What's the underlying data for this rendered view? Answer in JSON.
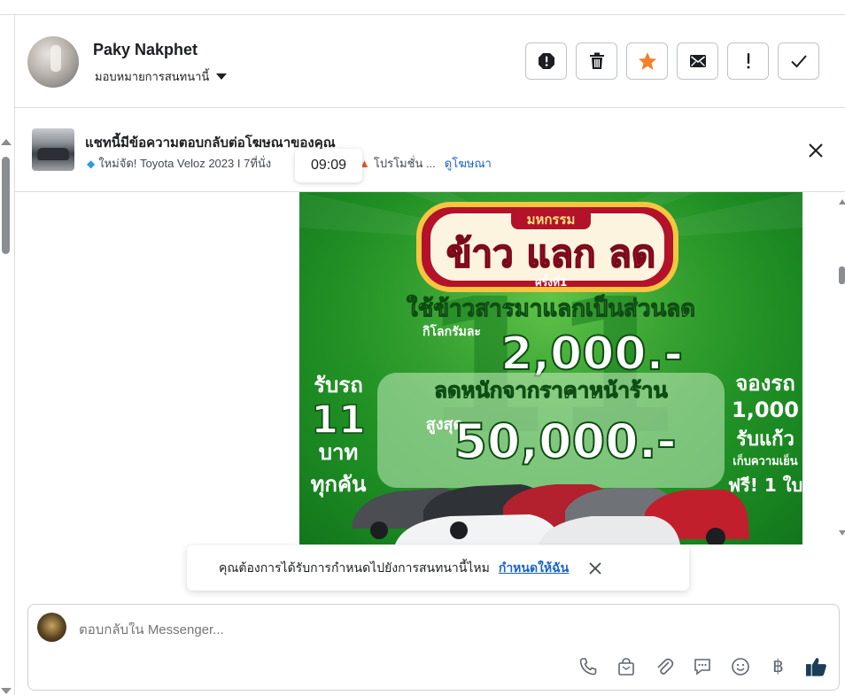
{
  "header": {
    "contact_name": "Paky Nakphet",
    "assign_label": "มอบหมายการสนทนานี้",
    "actions": [
      {
        "name": "spam-button",
        "icon": "alert-octagon-icon"
      },
      {
        "name": "delete-button",
        "icon": "trash-icon"
      },
      {
        "name": "star-button",
        "icon": "star-icon",
        "color": "#f5802a"
      },
      {
        "name": "mark-unread-button",
        "icon": "envelope-icon"
      },
      {
        "name": "follow-up-button",
        "icon": "exclamation-icon"
      },
      {
        "name": "mark-done-button",
        "icon": "checkmark-icon"
      }
    ]
  },
  "ad_banner": {
    "title": "แชทนี้มีข้อความตอบกลับต่อโฆษณาของคุณ",
    "preview_text_a": "ใหม่จัด! Toyota Veloz 2023 I 7ที่นั่ง",
    "preview_text_b": "!",
    "preview_text_c": "โปรโมชั่น ...",
    "view_ad_link": "ดูโฆษณา",
    "timestamp": "09:09"
  },
  "poster": {
    "badge_top": "มหกรรม",
    "headline": "ข้าว แลก ลด",
    "badge_round": "ครั้งที่1",
    "sub_headline": "ใช้ข้าวสารมาแลกเป็นส่วนลด",
    "per_kilo": "กิโลกรัมละ",
    "per_kilo_amount": "2,000.-",
    "discount_line": "ลดหนักจากราคาหน้าร้าน",
    "max_label": "สูงสุด",
    "max_amount": "50,000.-",
    "left_1": "รับรถ",
    "left_2": "11",
    "left_3": "บาท",
    "left_4": "ทุกคัน",
    "right_1": "จองรถ",
    "right_2": "1,000",
    "right_3": "รับแก้ว",
    "right_4": "เก็บความเย็น",
    "right_5": "ฟรี! 1 ใบ"
  },
  "toast": {
    "text": "คุณต้องการได้รับการกำหนดไปยังการสนทนานี้ไหม",
    "link": "กำหนดให้ฉัน"
  },
  "composer": {
    "placeholder": "ตอบกลับใน Messenger...",
    "tools": [
      "phone-icon",
      "shopping-bag-icon",
      "paperclip-icon",
      "saved-reply-icon",
      "emoji-icon",
      "baht-icon",
      "thumbs-up-icon"
    ],
    "baht_symbol": "฿",
    "like_color": "#1c3d5a"
  },
  "colors": {
    "accent_blue": "#1763cf",
    "poster_green": "#229526",
    "star_orange": "#f5802a"
  }
}
